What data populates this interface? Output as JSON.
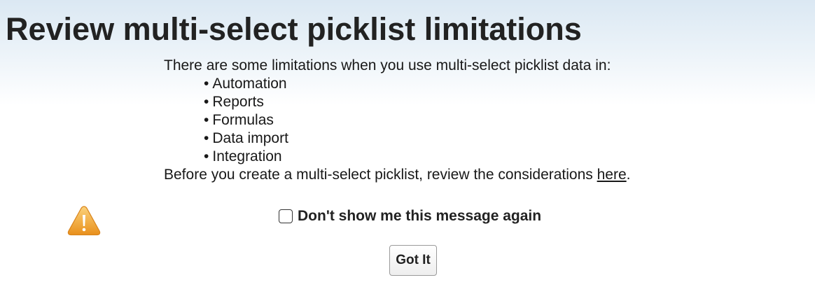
{
  "dialog": {
    "title": "Review multi-select picklist limitations",
    "intro": "There are some limitations when you use multi-select picklist data in:",
    "bullets": [
      "Automation",
      "Reports",
      "Formulas",
      "Data import",
      "Integration"
    ],
    "outro_prefix": "Before you create a multi-select picklist, review the considerations ",
    "link_text": "here",
    "outro_suffix": ".",
    "warning_icon": "warning-icon",
    "checkbox_label": "Don't show me this message again",
    "checkbox_checked": false,
    "button_label": "Got It"
  },
  "colors": {
    "header_gradient_top": "#dbe8f3",
    "warning_fill": "#f0a32b",
    "text": "#181818"
  }
}
